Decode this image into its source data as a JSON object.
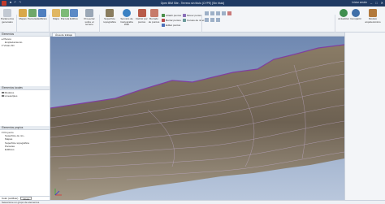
{
  "window": {
    "title": "Open BIM Site - Terreno sin título (CYPE) [Sin título]",
    "user_label": "Iniciar sesión",
    "minimize": "–",
    "maximize": "□",
    "close": "✕"
  },
  "ribbon": {
    "buttons": [
      {
        "label": "Parámetros generales"
      },
      {
        "label": "Mapas"
      },
      {
        "label": "Parcelas"
      },
      {
        "label": "Edificios"
      },
      {
        "label": "Mapa"
      },
      {
        "label": "Parcela"
      },
      {
        "label": "Edificio"
      },
      {
        "label": "Proyectar sobre el terreno"
      },
      {
        "label": "Superficie topográfica"
      },
      {
        "label": "Servicio de Cartografía Web"
      },
      {
        "label": "Definir por puntos"
      },
      {
        "label": "Borrado de puntos"
      },
      {
        "label": "Actualizar"
      },
      {
        "label": "Compartir"
      },
      {
        "label": "Modelo arquitectónico"
      }
    ],
    "small_buttons": [
      {
        "label": "Añadir puntos"
      },
      {
        "label": "Borrar puntos"
      },
      {
        "label": "Editar puntos"
      },
      {
        "label": "Mover puntos"
      },
      {
        "label": "Curvas de nivel"
      }
    ],
    "groups": {
      "proyecto": "Proyecto",
      "emplazamiento": "Componentes del emplazamiento",
      "superficie": "Superficie topográfica",
      "edicion": "Edición",
      "bimserver": "BIMserver.center"
    }
  },
  "left_panel": {
    "section1_title": "Elementos",
    "tree1": [
      "Planos",
      "Emplazamiento",
      "Vistas 3D"
    ],
    "section2_title": "Elementos locales",
    "tree2": [
      "Modelos",
      "Líneas/pies"
    ],
    "section3_title": "Elementos propios",
    "tree3": [
      "Proyecto",
      "Superficie de niv...",
      "Mapas",
      "Superficie topográfica",
      "Parcelas",
      "Edificios"
    ],
    "section4_title": "Filtro",
    "filter_label": "Color (cotificar)",
    "filter_value": "Altura"
  },
  "tabs": {
    "active": "Área de trabajo"
  },
  "status": "Seleccione un grupo de elementos",
  "colors": {
    "titlebar": "#1f3a63",
    "sky": "#8fa6c8",
    "terrain": "#7a6a58",
    "ridge": "#7f3fa0"
  }
}
